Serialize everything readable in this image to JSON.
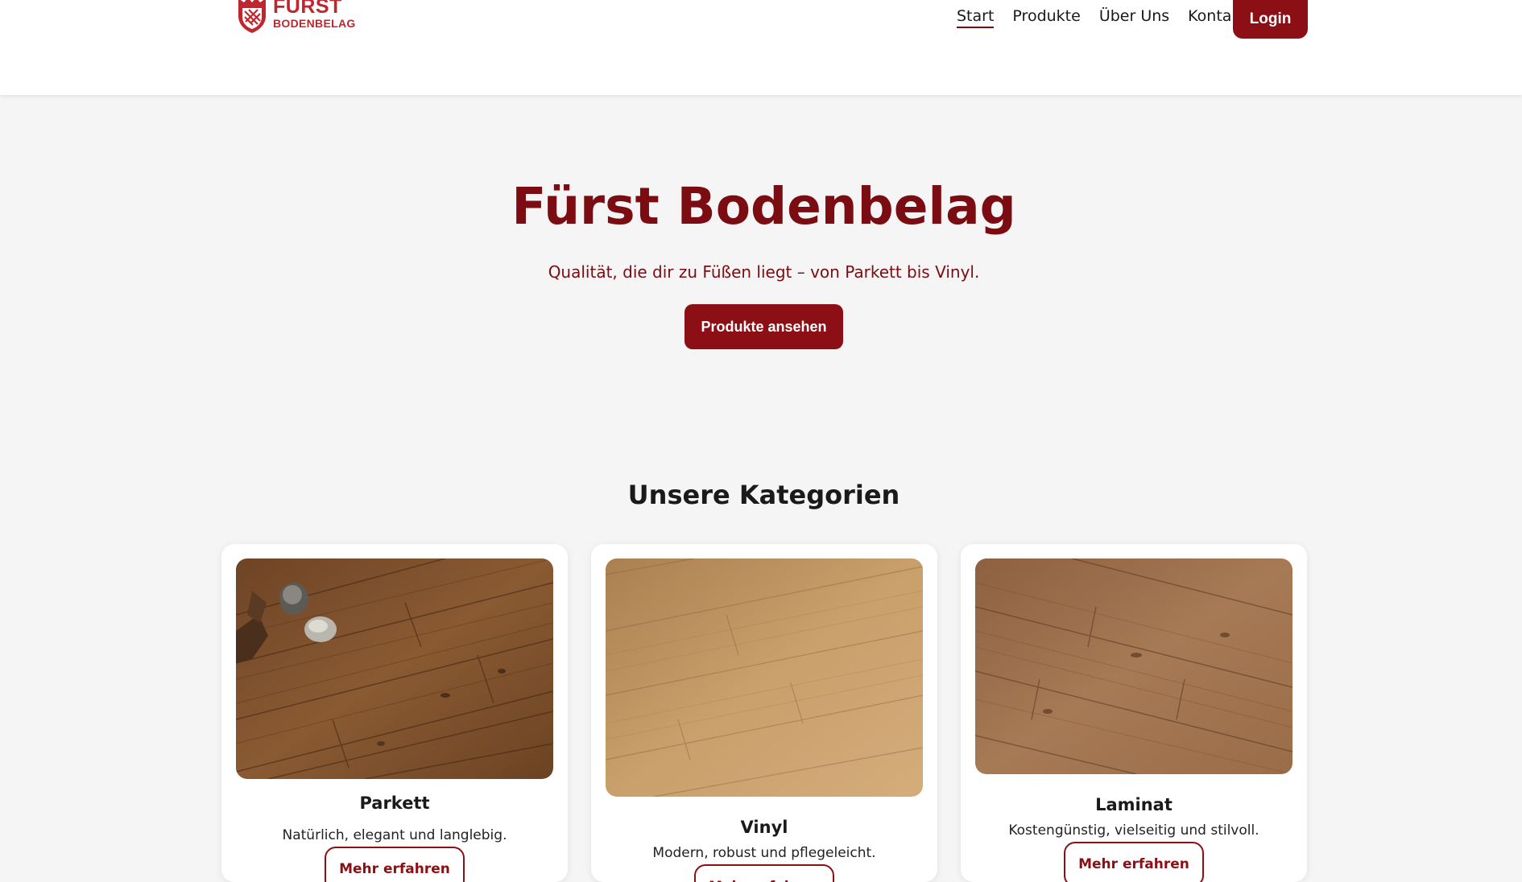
{
  "brand": {
    "name_top": "FÜRST",
    "name_bottom": "BODENBELAG",
    "color": "#c0262d"
  },
  "nav": {
    "items": [
      {
        "label": "Start",
        "active": true
      },
      {
        "label": "Produkte",
        "active": false
      },
      {
        "label": "Über Uns",
        "active": false
      },
      {
        "label": "Kontakt",
        "active": false
      }
    ],
    "login_label": "Login"
  },
  "hero": {
    "title": "Fürst Bodenbelag",
    "subtitle": "Qualität, die dir zu Füßen liegt – von Parkett bis Vinyl.",
    "cta_label": "Produkte ansehen"
  },
  "categories": {
    "heading": "Unsere Kategorien",
    "cards": [
      {
        "title": "Parkett",
        "description": "Natürlich, elegant und langlebig.",
        "button_label": "Mehr erfahren",
        "image": "parkett-floor-image"
      },
      {
        "title": "Vinyl",
        "description": "Modern, robust und pflegeleicht.",
        "button_label": "Mehr erfahren",
        "image": "vinyl-floor-image"
      },
      {
        "title": "Laminat",
        "description": "Kostengünstig, vielseitig und stilvoll.",
        "button_label": "Mehr erfahren",
        "image": "laminat-floor-image"
      }
    ]
  },
  "colors": {
    "accent": "#8b0f14",
    "title": "#7a0c12",
    "background": "#f5f5f5"
  }
}
